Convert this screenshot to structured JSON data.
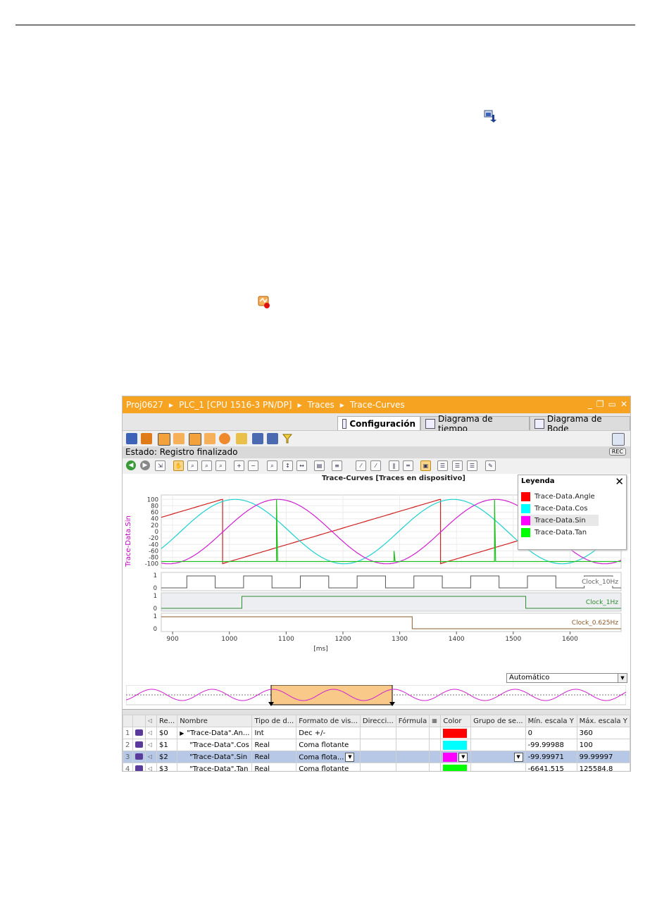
{
  "breadcrumb": [
    "Proj0627",
    "PLC_1 [CPU 1516-3 PN/DP]",
    "Traces",
    "Trace-Curves"
  ],
  "window_controls": [
    "_",
    "❐",
    "▭",
    "✕"
  ],
  "tabs": [
    {
      "label": "Configuración",
      "active": true
    },
    {
      "label": "Diagrama de tiempo",
      "active": false
    },
    {
      "label": "Diagrama de Bode",
      "active": false
    }
  ],
  "status": "Estado: Registro finalizado",
  "rec_badge": "REC",
  "chart_title": "Trace-Curves [Traces en dispositivo]",
  "legend": {
    "title": "Leyenda",
    "close": "✕",
    "items": [
      {
        "label": "Trace-Data.Angle",
        "color": "#ff0000"
      },
      {
        "label": "Trace-Data.Cos",
        "color": "#00ffff"
      },
      {
        "label": "Trace-Data.Sin",
        "color": "#ff00ff"
      },
      {
        "label": "Trace-Data.Tan",
        "color": "#00ff00"
      }
    ]
  },
  "y_axis_label": "Trace-Data.Sin",
  "x_unit": "[ms]",
  "x_dropdown": "Automático",
  "chart_data": {
    "type": "line",
    "x_ticks": [
      900,
      1000,
      1100,
      1200,
      1300,
      1400,
      1500,
      1600
    ],
    "xlim": [
      880,
      1690
    ],
    "analog": {
      "ylim": [
        -105,
        105
      ],
      "y_ticks": [
        100,
        80,
        60,
        40,
        20,
        0,
        -20,
        -40,
        -60,
        -80,
        -100
      ],
      "series": [
        {
          "name": "Trace-Data.Angle",
          "color": "#d02020",
          "sawtooth": {
            "period_ms": 384,
            "reset_at": [
              987,
              1370
            ],
            "min": -100,
            "max": 100
          }
        },
        {
          "name": "Trace-Data.Cos",
          "color": "#20d0d0",
          "sine": {
            "period_ms": 384,
            "peak_at": 1010,
            "amplitude": 100
          }
        },
        {
          "name": "Trace-Data.Sin",
          "color": "#d020d0",
          "sine": {
            "period_ms": 384,
            "peak_at": 1085,
            "amplitude": 100
          }
        },
        {
          "name": "Trace-Data.Tan",
          "color": "#20c020",
          "spikes_up": [
            1083,
            1467
          ],
          "spikes_down": [
            1290
          ],
          "baseline": -93
        }
      ]
    },
    "digital": [
      {
        "name": "Clock_10Hz",
        "color": "#555555",
        "label_color": "#666666",
        "edges": [
          925,
          975,
          1025,
          1075,
          1125,
          1175,
          1225,
          1275,
          1325,
          1375,
          1425,
          1475,
          1525,
          1575,
          1625,
          1675
        ],
        "start": 0,
        "y_ticks": [
          1,
          0
        ]
      },
      {
        "name": "Clock_1Hz",
        "color": "#2e8b2e",
        "label_color": "#2e8b2e",
        "edges": [
          1022,
          1522
        ],
        "start": 0,
        "y_ticks": [
          1,
          0
        ]
      },
      {
        "name": "Clock_0.625Hz",
        "color": "#8b5a2b",
        "label_color": "#8b5a2b",
        "edges": [
          1322
        ],
        "start": 1,
        "y_ticks": [
          1,
          0
        ]
      }
    ]
  },
  "table": {
    "headers": [
      "",
      "",
      "",
      "Re...",
      "Nombre",
      "Tipo de d...",
      "Formato de vis...",
      "Direcci...",
      "Fórmula",
      "",
      "Color",
      "Grupo de se...",
      "Mín. escala Y",
      "Máx. escala Y"
    ],
    "rows": [
      {
        "idx": "1",
        "ref": "$0",
        "name": "\"Trace-Data\".An...",
        "expand": "▶",
        "type": "Int",
        "format": "Dec +/-",
        "color": "#ff0000",
        "min": "0",
        "max": "360",
        "selected": false
      },
      {
        "idx": "2",
        "ref": "$1",
        "name": "\"Trace-Data\".Cos",
        "expand": "",
        "type": "Real",
        "format": "Coma flotante",
        "color": "#00ffff",
        "min": "-99.99988",
        "max": "100",
        "selected": false
      },
      {
        "idx": "3",
        "ref": "$2",
        "name": "\"Trace-Data\".Sin",
        "expand": "",
        "type": "Real",
        "format": "Coma flota...",
        "color": "#ff00ff",
        "min": "-99.99971",
        "max": "99.99997",
        "selected": true
      },
      {
        "idx": "4",
        "ref": "$3",
        "name": "\"Trace-Data\".Tan",
        "expand": "",
        "type": "Real",
        "format": "Coma flotante",
        "color": "#00ff00",
        "min": "-6641.515",
        "max": "125584.8",
        "selected": false
      }
    ]
  }
}
